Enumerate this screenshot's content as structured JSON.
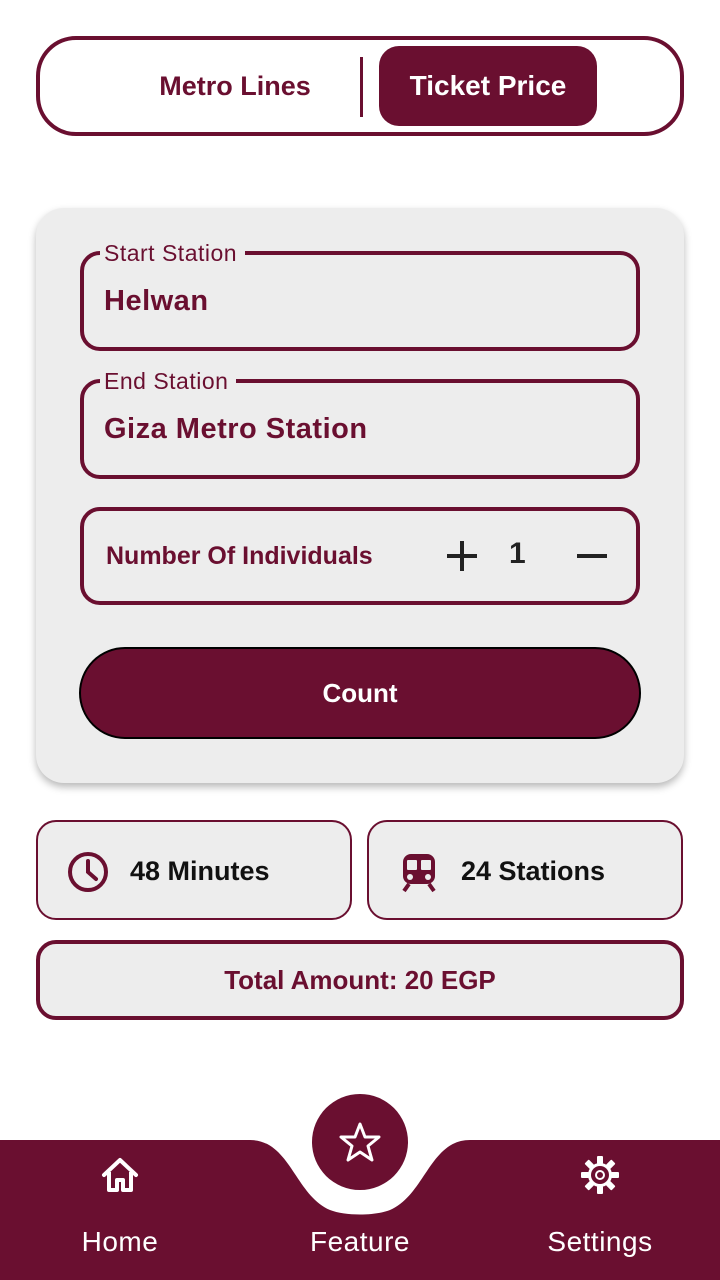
{
  "colors": {
    "primary": "#6a0f30",
    "card_bg": "#ededed",
    "text_dark": "#111111",
    "white": "#ffffff"
  },
  "tabs": {
    "metro_lines": "Metro Lines",
    "ticket_price": "Ticket Price",
    "selected": "Ticket Price"
  },
  "form": {
    "start_station": {
      "label": "Start Station",
      "value": "Helwan"
    },
    "end_station": {
      "label": "End Station",
      "value": "Giza Metro Station"
    },
    "individuals": {
      "label": "Number Of Individuals",
      "value": "1",
      "plus_icon": "plus-icon",
      "minus_icon": "minus-icon"
    },
    "count_button": "Count"
  },
  "results": {
    "duration": {
      "icon": "clock-icon",
      "text": "48 Minutes"
    },
    "stations": {
      "icon": "train-icon",
      "text": "24 Stations"
    },
    "total": "Total Amount: 20 EGP"
  },
  "bottom_nav": {
    "items": [
      {
        "label": "Home",
        "icon": "home-icon"
      },
      {
        "label": "Feature",
        "icon": "star-icon"
      },
      {
        "label": "Settings",
        "icon": "gear-icon"
      }
    ],
    "active": "Feature"
  }
}
